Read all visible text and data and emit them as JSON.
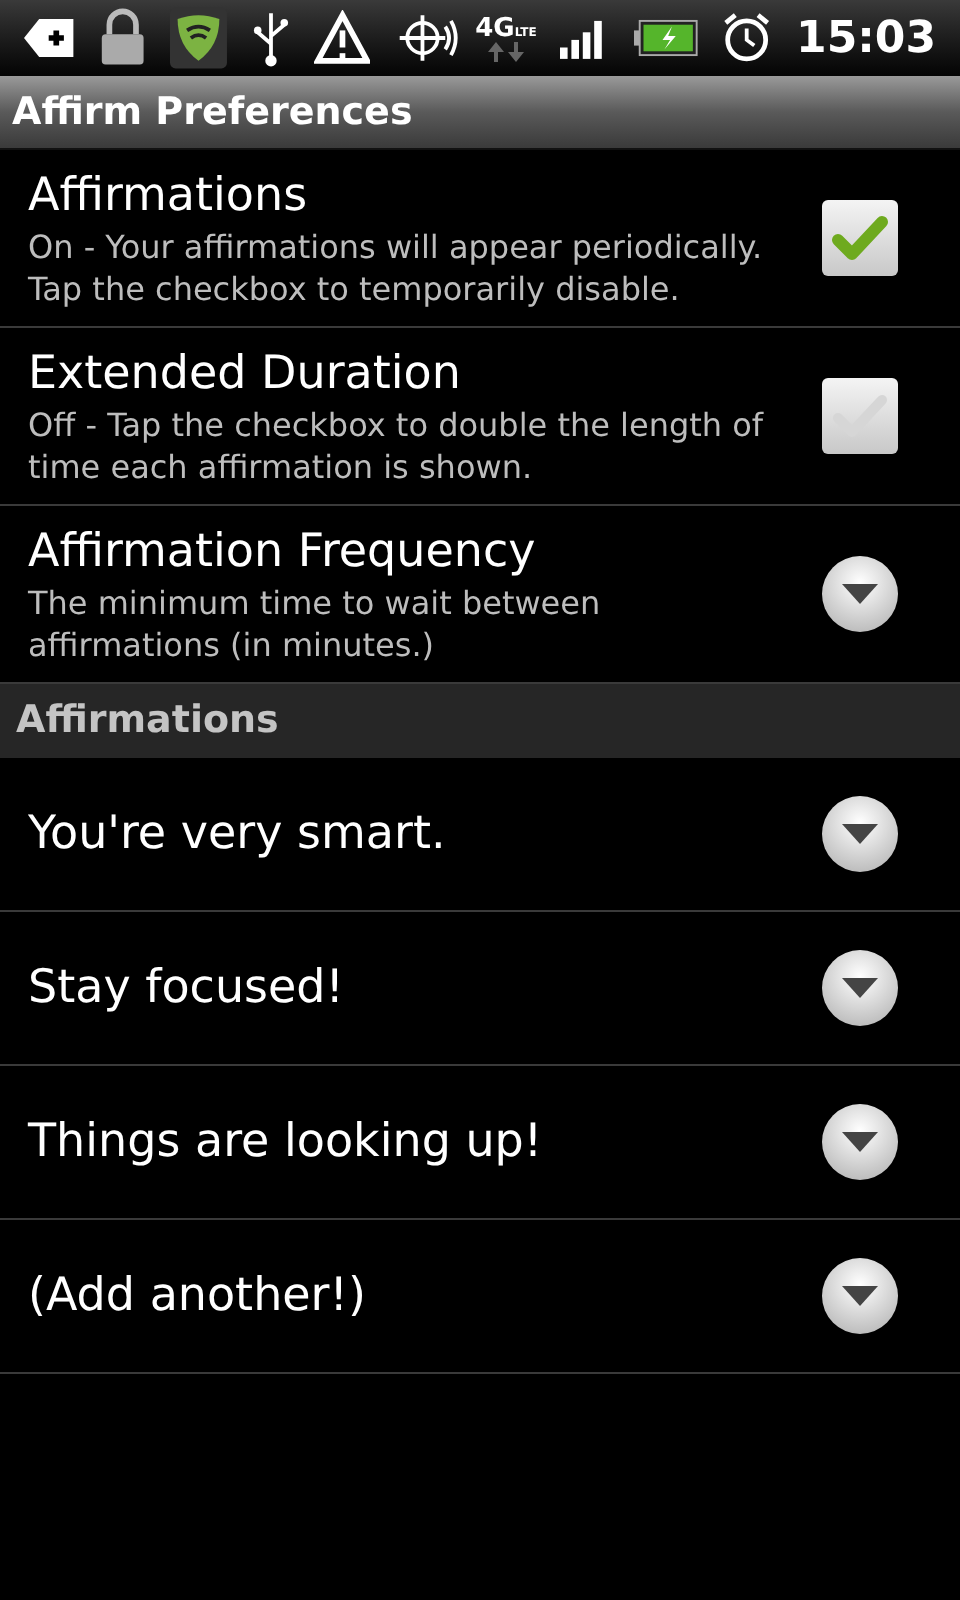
{
  "status_bar": {
    "network": "4G",
    "network_sub": "LTE",
    "time": "15:03"
  },
  "title_bar": {
    "title": "Affirm Preferences"
  },
  "preferences": [
    {
      "kind": "checkbox",
      "title": "Affirmations",
      "summary": "On - Your affirmations will appear periodically. Tap the checkbox to temporarily disable.",
      "checked": true
    },
    {
      "kind": "checkbox",
      "title": "Extended Duration",
      "summary": "Off - Tap the checkbox to double the length of time each affirmation is shown.",
      "checked": false
    },
    {
      "kind": "dropdown",
      "title": "Affirmation Frequency",
      "summary": "The minimum time to wait between affirmations (in minutes.)"
    }
  ],
  "section_header": "Affirmations",
  "affirmations": [
    {
      "text": "You're very smart."
    },
    {
      "text": "Stay focused!"
    },
    {
      "text": "Things are looking up!"
    },
    {
      "text": "(Add another!)"
    }
  ]
}
